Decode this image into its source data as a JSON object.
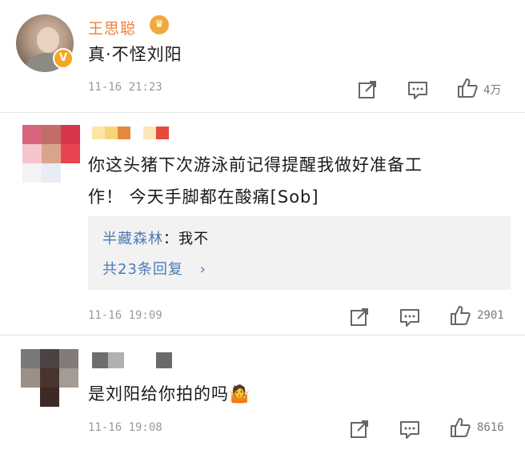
{
  "comments": [
    {
      "username": "王思聪",
      "text": "真·不怪刘阳",
      "timestamp": "11-16 21:23",
      "likes": "4万",
      "icons": [
        "share-icon",
        "comment-icon",
        "like-icon"
      ]
    },
    {
      "text_line1": "你这头猪下次游泳前记得提醒我做好准备工",
      "text_line2": "作！ 今天手脚都在酸痛[Sob]",
      "reply": {
        "user": "半藏森林",
        "separator": "：",
        "text": "我不",
        "count_label": "共23条回复",
        "chevron": "›"
      },
      "timestamp": "11-16 19:09",
      "likes": "2901"
    },
    {
      "text": "是刘阳给你拍的吗",
      "emoji": "🤷",
      "timestamp": "11-16 19:08",
      "likes": "8616"
    }
  ],
  "colors": {
    "username_orange": "#e8833a",
    "reply_blue": "#4c7ab5",
    "timestamp_gray": "#9a9a9a"
  }
}
